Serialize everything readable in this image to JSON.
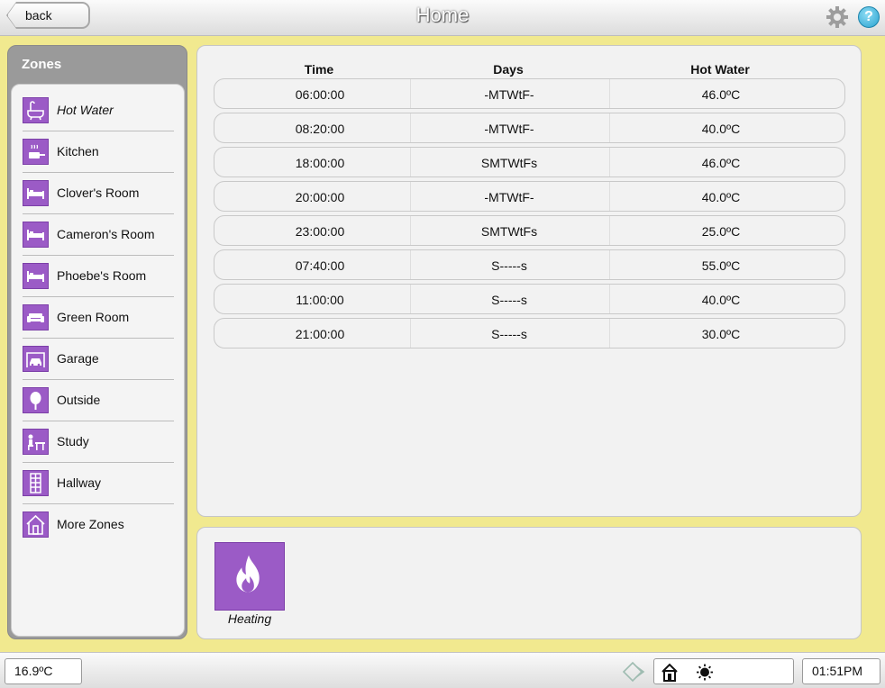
{
  "header": {
    "back_label": "back",
    "title": "Home"
  },
  "zones": {
    "title": "Zones",
    "items": [
      {
        "label": "Hot Water",
        "icon": "bath-icon",
        "active": true
      },
      {
        "label": "Kitchen",
        "icon": "cooking-pot-icon"
      },
      {
        "label": "Clover's Room",
        "icon": "bed-icon"
      },
      {
        "label": "Cameron's Room",
        "icon": "bed-icon"
      },
      {
        "label": "Phoebe's Room",
        "icon": "bed-icon"
      },
      {
        "label": "Green Room",
        "icon": "sofa-icon"
      },
      {
        "label": "Garage",
        "icon": "car-icon"
      },
      {
        "label": "Outside",
        "icon": "tree-icon"
      },
      {
        "label": "Study",
        "icon": "desk-icon"
      },
      {
        "label": "Hallway",
        "icon": "door-icon"
      },
      {
        "label": "More Zones",
        "icon": "house-icon"
      }
    ]
  },
  "schedule": {
    "headers": {
      "time": "Time",
      "days": "Days",
      "value": "Hot Water"
    },
    "rows": [
      {
        "time": "06:00:00",
        "days": "-MTWtF-",
        "value": "46.0ºC"
      },
      {
        "time": "08:20:00",
        "days": "-MTWtF-",
        "value": "40.0ºC"
      },
      {
        "time": "18:00:00",
        "days": "SMTWtFs",
        "value": "46.0ºC"
      },
      {
        "time": "20:00:00",
        "days": "-MTWtF-",
        "value": "40.0ºC"
      },
      {
        "time": "23:00:00",
        "days": "SMTWtFs",
        "value": "25.0ºC"
      },
      {
        "time": "07:40:00",
        "days": "S-----s",
        "value": "55.0ºC"
      },
      {
        "time": "11:00:00",
        "days": "S-----s",
        "value": "40.0ºC"
      },
      {
        "time": "21:00:00",
        "days": "S-----s",
        "value": "30.0ºC"
      }
    ]
  },
  "modes": {
    "items": [
      {
        "label": "Heating",
        "icon": "flame-icon"
      }
    ]
  },
  "status": {
    "temperature": "16.9ºC",
    "time": "01:51PM"
  },
  "colors": {
    "accent": "#9b5bc6",
    "background": "#f1e98f",
    "help": "#2aa3d0"
  }
}
